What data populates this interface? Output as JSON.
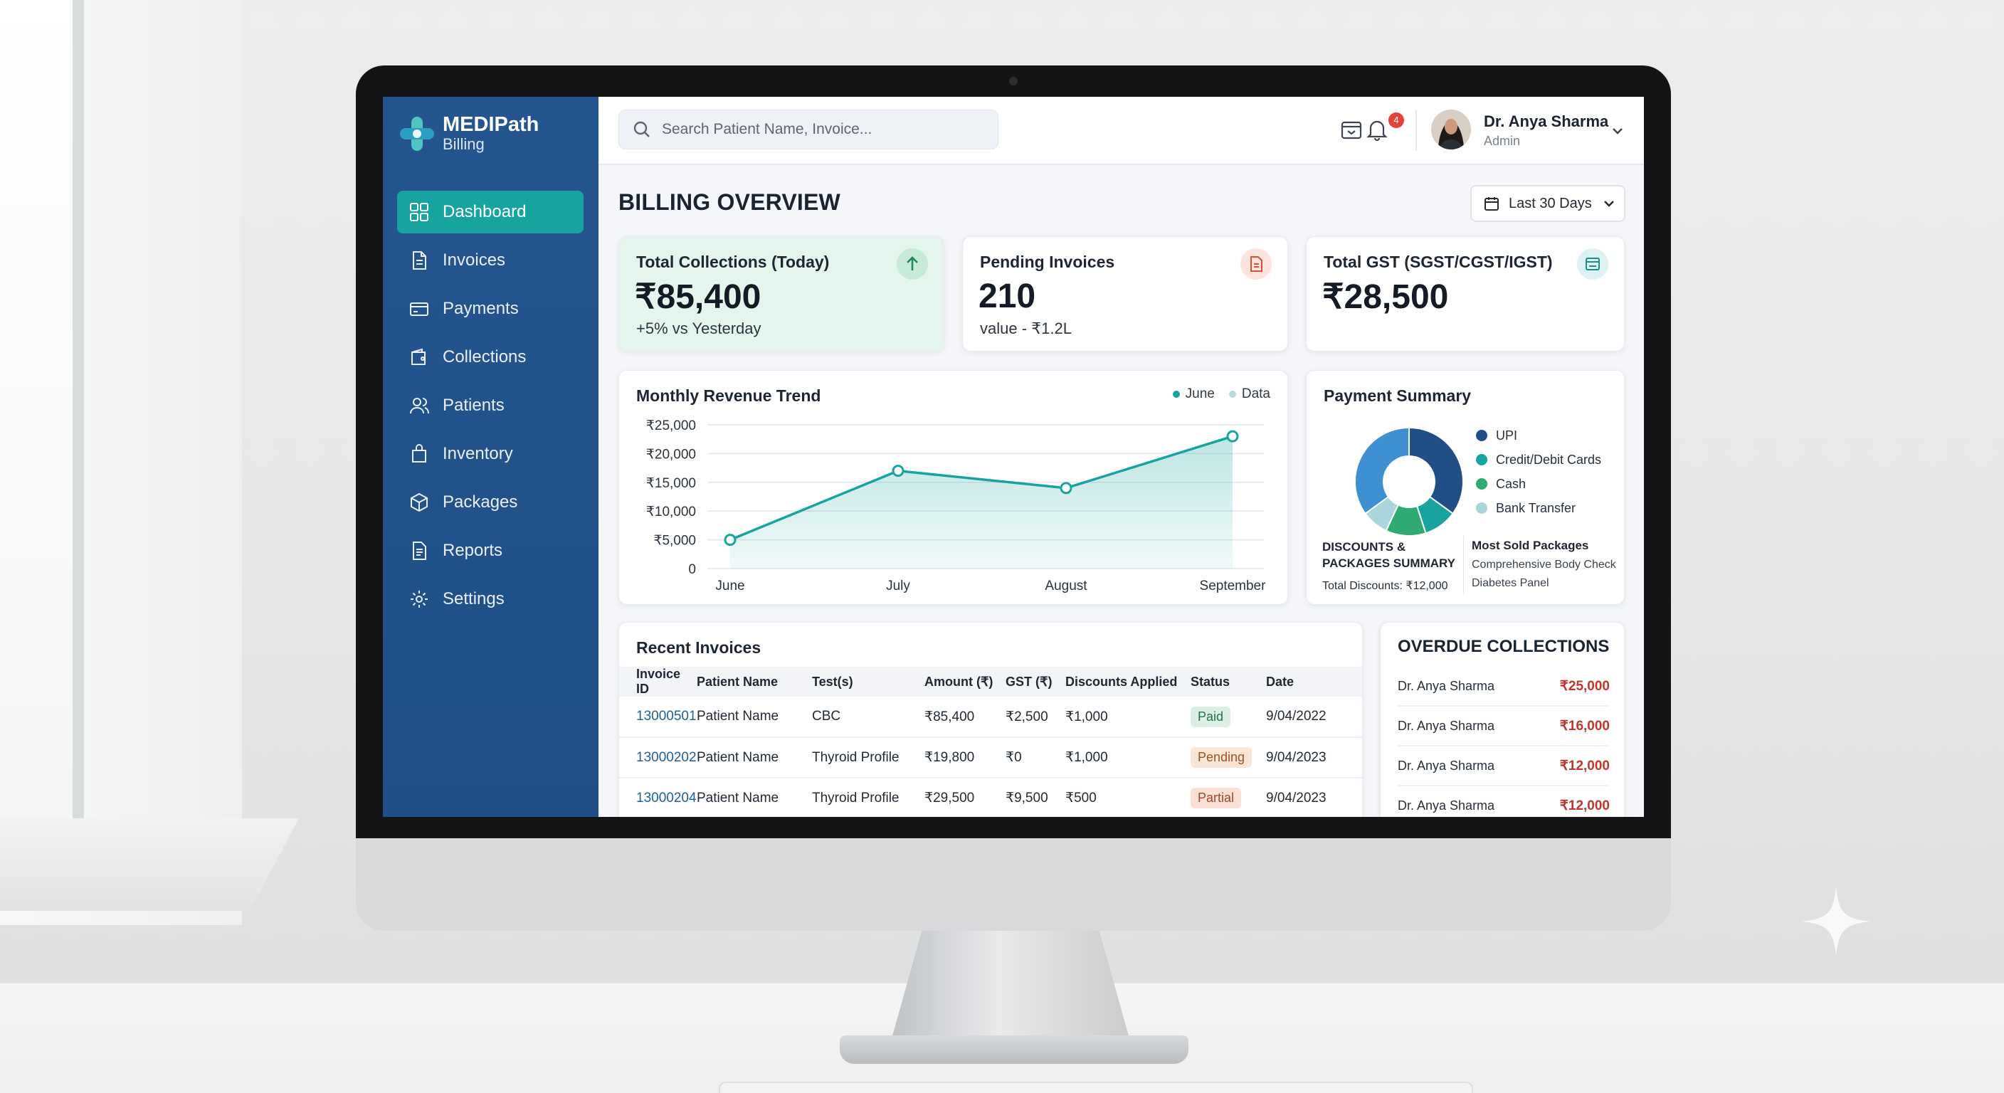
{
  "app": {
    "brand_name": "MEDIPath",
    "brand_sub": "Billing",
    "accent": "#17a3a0",
    "sidebar_color": "#24558f"
  },
  "sidebar": {
    "items": [
      {
        "label": "Dashboard",
        "icon": "grid-icon"
      },
      {
        "label": "Invoices",
        "icon": "document-icon"
      },
      {
        "label": "Payments",
        "icon": "card-icon"
      },
      {
        "label": "Collections",
        "icon": "wallet-icon"
      },
      {
        "label": "Patients",
        "icon": "users-icon"
      },
      {
        "label": "Inventory",
        "icon": "bag-icon"
      },
      {
        "label": "Packages",
        "icon": "box-icon"
      },
      {
        "label": "Reports",
        "icon": "report-icon"
      },
      {
        "label": "Settings",
        "icon": "gear-icon"
      }
    ]
  },
  "topbar": {
    "search_placeholder": "Search Patient Name, Invoice...",
    "notification_count": "4",
    "user_name": "Dr. Anya Sharma",
    "user_role": "Admin"
  },
  "main": {
    "title": "BILLING OVERVIEW",
    "range": "Last 30 Days"
  },
  "kpis": [
    {
      "label": "Total Collections (Today)",
      "value": "₹85,400",
      "sub": "+5% vs Yesterday",
      "icon": "arrow-up-icon"
    },
    {
      "label": "Pending Invoices",
      "value": "210",
      "sub": "value - ₹1.2L",
      "icon": "document-icon"
    },
    {
      "label": "Total GST (SGST/CGST/IGST)",
      "value": "₹28,500",
      "sub": "",
      "icon": "receipt-icon"
    }
  ],
  "chart_data": {
    "type": "area",
    "title": "Monthly Revenue Trend",
    "legend": [
      "June",
      "Data"
    ],
    "categories": [
      "June",
      "July",
      "August",
      "September"
    ],
    "values": [
      5000,
      17000,
      14000,
      23000
    ],
    "yticks": [
      "₹25,000",
      "₹20,000",
      "₹15,000",
      "₹10,000",
      "₹5,000",
      "0"
    ],
    "ylim": [
      0,
      25000
    ],
    "grid": true,
    "color": "#17a3a0"
  },
  "payment_summary": {
    "title": "Payment Summary",
    "slices": [
      {
        "label": "UPI",
        "value": 35,
        "color": "#1f4f86"
      },
      {
        "label": "Credit/Debit Cards",
        "value": 10,
        "color": "#17a3a0"
      },
      {
        "label": "Cash",
        "value": 12,
        "color": "#2eaa72"
      },
      {
        "label": "Bank Transfer",
        "value": 8,
        "color": "#a9d6dc"
      },
      {
        "label": "",
        "value": 35,
        "color": "#3f8fd3"
      }
    ],
    "discounts_title": "DISCOUNTS & PACKAGES SUMMARY",
    "discounts_total": "Total Discounts: ₹12,000",
    "sold_title": "Most Sold Packages",
    "sold_items": [
      "Comprehensive Body Check",
      "Diabetes Panel"
    ]
  },
  "invoices": {
    "title": "Recent Invoices",
    "columns": [
      "Invoice ID",
      "Patient Name",
      "Test(s)",
      "Amount (₹)",
      "GST (₹)",
      "Discounts Applied",
      "Status",
      "Date"
    ],
    "rows": [
      {
        "id": "13000501",
        "patient": "Patient Name",
        "tests": "CBC",
        "amount": "₹85,400",
        "gst": "₹2,500",
        "discount": "₹1,000",
        "status": "Paid",
        "status_class": "paid",
        "date": "9/04/2022"
      },
      {
        "id": "13000202",
        "patient": "Patient Name",
        "tests": "Thyroid Profile",
        "amount": "₹19,800",
        "gst": "₹0",
        "discount": "₹1,000",
        "status": "Pending",
        "status_class": "pending",
        "date": "9/04/2023"
      },
      {
        "id": "13000204",
        "patient": "Patient Name",
        "tests": "Thyroid Profile",
        "amount": "₹29,500",
        "gst": "₹9,500",
        "discount": "₹500",
        "status": "Partial",
        "status_class": "partial",
        "date": "9/04/2023"
      }
    ]
  },
  "overdue": {
    "title": "OVERDUE COLLECTIONS",
    "rows": [
      {
        "name": "Dr. Anya Sharma",
        "amount": "₹25,000"
      },
      {
        "name": "Dr. Anya Sharma",
        "amount": "₹16,000"
      },
      {
        "name": "Dr. Anya Sharma",
        "amount": "₹12,000"
      },
      {
        "name": "Dr. Anya Sharma",
        "amount": "₹12,000"
      }
    ]
  }
}
